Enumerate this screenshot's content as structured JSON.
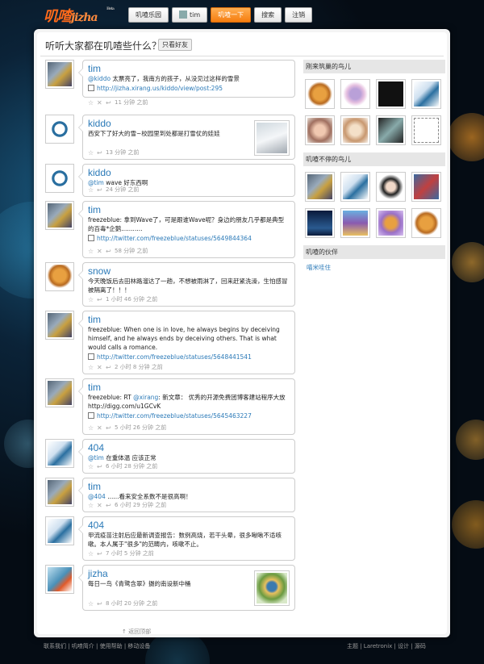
{
  "brand": {
    "logo_text": "叽喳",
    "logo_sub": "jizha",
    "beta": "Beta"
  },
  "nav": {
    "items": [
      {
        "label": "叽喳乐园"
      },
      {
        "label": "tim"
      },
      {
        "label": "叽喳一下"
      },
      {
        "label": "搜索"
      },
      {
        "label": "注销"
      }
    ]
  },
  "composer": {
    "prompt": "听听大家都在叽喳些什么？",
    "filter": "只看好友"
  },
  "feed": [
    {
      "user": "tim",
      "text_prefix": "",
      "mention": "@kiddo",
      "text": " 太票亮了，我南方的孩子，从没见过这样的雪景",
      "link": "http://jizha.xirang.us/kiddo/view/post:295",
      "time": "11 分钟 之前"
    },
    {
      "user": "kiddo",
      "text_prefix": "",
      "mention": "",
      "text": "西安下了好大的雪~校园里到处都是打雪仗的娃娃",
      "link": "",
      "time": "13 分钟 之前"
    },
    {
      "user": "kiddo",
      "text_prefix": "",
      "mention": "@tim",
      "text": " wave 好东西啊",
      "link": "",
      "time": "24 分钟 之前"
    },
    {
      "user": "tim",
      "text_prefix": "freezeblue: ",
      "mention": "",
      "text": "拿到Wave了，可是跟谁Wave呢？身边的朋友几乎都是典型的百毒*企鹅...........",
      "link": "http://twitter.com/freezeblue/statuses/5649844364",
      "time": "58 分钟 之前"
    },
    {
      "user": "snow",
      "text_prefix": "",
      "mention": "",
      "text": "今天晚饭后去田林路溜达了一趟，不想被雨淋了，回来赶紧洗澡，生怕感冒被隔离了！！！",
      "link": "",
      "time": "1 小时 46 分钟 之前"
    },
    {
      "user": "tim",
      "text_prefix": "freezeblue: ",
      "mention": "",
      "text": "When one is in love, he always begins by deceiving himself, and he always ends by deceiving others. That is what would calls a romance.",
      "link": "http://twitter.com/freezeblue/statuses/5648441541",
      "time": "2 小时 8 分钟 之前"
    },
    {
      "user": "tim",
      "text_prefix": "freezeblue: RT ",
      "mention": "@xirang",
      "text": ": 新文章： 优秀的开源免费团博客建站程序大放 http://digg.com/u1GCvK",
      "link": "http://twitter.com/freezeblue/statuses/5645463227",
      "time": "5 小时 26 分钟 之前"
    },
    {
      "user": "404",
      "text_prefix": "",
      "mention": "@tim",
      "text": " 在重体温 应该正常",
      "link": "",
      "time": "6 小时 28 分钟 之前"
    },
    {
      "user": "tim",
      "text_prefix": "",
      "mention": "@404",
      "text": " ......看来安全系数不是很高啊！",
      "link": "",
      "time": "6 小时 29 分钟 之前"
    },
    {
      "user": "404",
      "text_prefix": "",
      "mention": "",
      "text": "甲流疫苗注射后应最新调查报告：数例高烧，若干头晕，很多啾啾不适咳嗽。本人属于\"很多\"的范畴内，咳嗽不止。",
      "link": "",
      "time": "7 小时 5 分钟 之前"
    },
    {
      "user": "jizha",
      "text_prefix": "",
      "mention": "",
      "text": "每日一鸟《青鹭含翠》摄的南设新中桶",
      "link": "",
      "time": "8 小时 20 分钟 之前"
    }
  ],
  "sidebar": {
    "new_birds_title": "刚来筑巢的鸟儿",
    "active_birds_title": "叽喳不停的鸟儿",
    "partners_title": "叽喳的伙伴",
    "partners_link": "喵米哇住"
  },
  "back_to_top": "返回顶部",
  "footer": {
    "left": "联系我们 | 叽喳简介 | 使用帮助 | 移动设备",
    "right": "主题 | Laretronix | 设计 | 源码"
  },
  "colors": {
    "accent": "#f57d0f",
    "link": "#2b7ab8"
  }
}
